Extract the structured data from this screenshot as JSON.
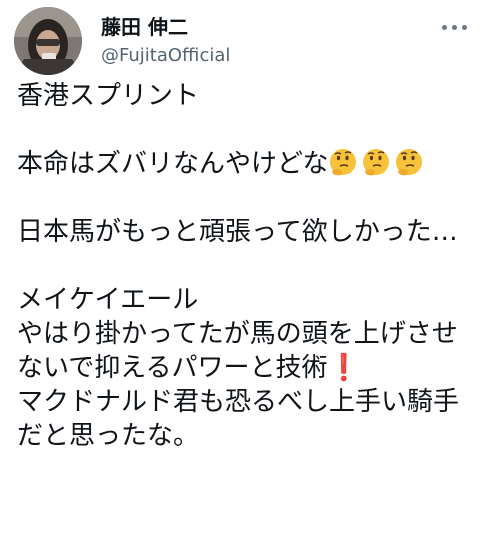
{
  "user": {
    "display_name": "藤田 伸二",
    "handle": "@FujitaOfficial"
  },
  "tweet": {
    "line1": "香港スプリント",
    "line2_text": "本命はズバリなんやけどな",
    "line2_emoji": [
      "thinking-face-icon",
      "thinking-face-icon",
      "thinking-face-icon"
    ],
    "para2": "日本馬がもっと頑張って欲しかった…",
    "line_name": "メイケイエール",
    "line_body_a": "やはり掛かってたが馬の頭を上げさせないで抑えるパワーと技術",
    "exclamation": "❗",
    "line_body_b": "マクドナルド君も恐るべし上手い騎手だと思ったな。"
  },
  "colors": {
    "text": "#0f1419",
    "handle": "#536471",
    "exclamation": "#d81b2c"
  }
}
